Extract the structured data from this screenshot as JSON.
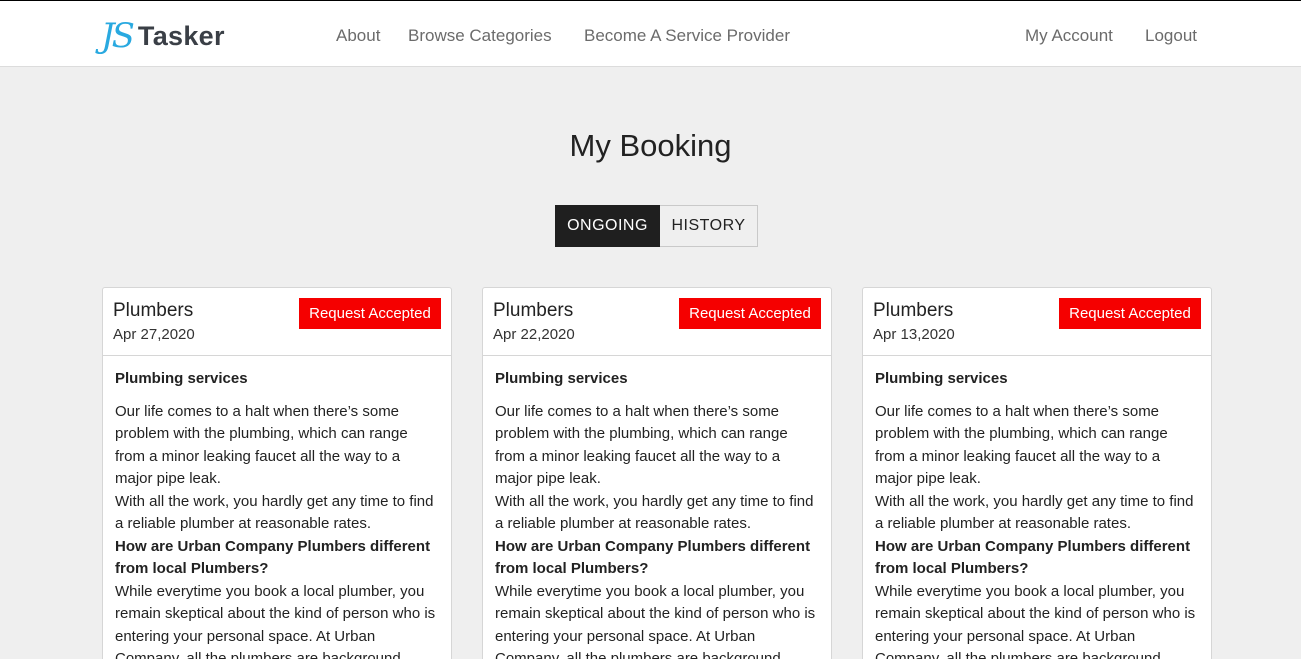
{
  "brand": {
    "mark": "JS",
    "name": "Tasker"
  },
  "nav": {
    "about": "About",
    "browse": "Browse Categories",
    "become": "Become A Service Provider",
    "account": "My Account",
    "logout": "Logout"
  },
  "page": {
    "title": "My Booking"
  },
  "tabs": {
    "ongoing": "ONGOING",
    "history": "HISTORY"
  },
  "colors": {
    "badge": "#f50000",
    "logo_accent": "#29a9e0",
    "active_tab": "#1f1f1f"
  },
  "bookings": [
    {
      "category": "Plumbers",
      "date": "Apr 27,2020",
      "status": "Request Accepted",
      "service_title": "Plumbing services",
      "para1": "Our life comes to a halt when there’s some problem with the plumbing, which can range from a minor leaking faucet all the way to a major pipe leak.",
      "para2": "With all the work, you hardly get any time to find a reliable plumber at reasonable rates.",
      "question": "How are Urban Company Plumbers different from local Plumbers?",
      "para3": "While everytime you book a local plumber, you remain skeptical about the kind of person who is entering your personal space. At Urban Company, all the plumbers are background"
    },
    {
      "category": "Plumbers",
      "date": "Apr 22,2020",
      "status": "Request Accepted",
      "service_title": "Plumbing services",
      "para1": "Our life comes to a halt when there’s some problem with the plumbing, which can range from a minor leaking faucet all the way to a major pipe leak.",
      "para2": "With all the work, you hardly get any time to find a reliable plumber at reasonable rates.",
      "question": "How are Urban Company Plumbers different from local Plumbers?",
      "para3": "While everytime you book a local plumber, you remain skeptical about the kind of person who is entering your personal space. At Urban Company, all the plumbers are background"
    },
    {
      "category": "Plumbers",
      "date": "Apr 13,2020",
      "status": "Request Accepted",
      "service_title": "Plumbing services",
      "para1": "Our life comes to a halt when there’s some problem with the plumbing, which can range from a minor leaking faucet all the way to a major pipe leak.",
      "para2": "With all the work, you hardly get any time to find a reliable plumber at reasonable rates.",
      "question": "How are Urban Company Plumbers different from local Plumbers?",
      "para3": "While everytime you book a local plumber, you remain skeptical about the kind of person who is entering your personal space. At Urban Company, all the plumbers are background"
    }
  ]
}
